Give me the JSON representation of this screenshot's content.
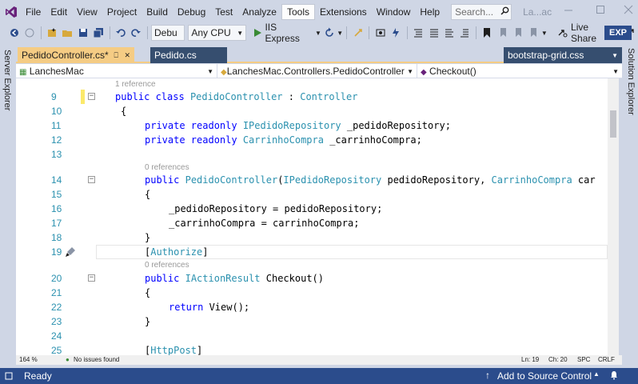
{
  "menu": {
    "items": [
      "File",
      "Edit",
      "View",
      "Project",
      "Build",
      "Debug",
      "Test",
      "Analyze",
      "Tools",
      "Extensions",
      "Window",
      "Help"
    ],
    "active": "Tools",
    "search_placeholder": "Search...",
    "solution_name": "La...ac"
  },
  "toolbar": {
    "config": "Debu",
    "platform": "Any CPU",
    "run_target": "IIS Express",
    "live_share": "Live Share",
    "exp_badge": "EXP"
  },
  "side_panels": {
    "left": "Server Explorer",
    "right": "Solution Explorer"
  },
  "tabs": {
    "active": "PedidoController.cs*",
    "inactive": "Pedido.cs",
    "preview": "bootstrap-grid.css"
  },
  "nav": {
    "project": "LanchesMac",
    "class": "LanchesMac.Controllers.PedidoController",
    "member": "Checkout()"
  },
  "code": {
    "lines": [
      {
        "n": "9",
        "ref": "1 reference",
        "text": "public class PedidoController : Controller"
      },
      {
        "n": "10",
        "text": "{"
      },
      {
        "n": "11",
        "text": "private readonly IPedidoRepository _pedidoRepository;"
      },
      {
        "n": "12",
        "text": "private readonly CarrinhoCompra _carrinhoCompra;"
      },
      {
        "n": "13",
        "text": ""
      },
      {
        "n": "14",
        "ref": "0 references",
        "text": "public PedidoController(IPedidoRepository pedidoRepository, CarrinhoCompra car"
      },
      {
        "n": "15",
        "text": "{"
      },
      {
        "n": "16",
        "text": "_pedidoRepository = pedidoRepository;"
      },
      {
        "n": "17",
        "text": "_carrinhoCompra = carrinhoCompra;"
      },
      {
        "n": "18",
        "text": "}"
      },
      {
        "n": "19",
        "text": "[Authorize]"
      },
      {
        "n": "20",
        "ref": "0 references",
        "text": "public IActionResult Checkout()"
      },
      {
        "n": "21",
        "text": "{"
      },
      {
        "n": "22",
        "text": "return View();"
      },
      {
        "n": "23",
        "text": "}"
      },
      {
        "n": "24",
        "text": ""
      },
      {
        "n": "25",
        "text": "[HttpPost]"
      }
    ]
  },
  "editor_status": {
    "zoom": "164 %",
    "issues": "No issues found",
    "line": "Ln: 19",
    "col": "Ch: 20",
    "spc": "SPC",
    "crlf": "CRLF"
  },
  "status": {
    "ready": "Ready",
    "source_control": "Add to Source Control"
  },
  "colors": {
    "accent": "#2b4c8c",
    "tab_active": "#f5cc84",
    "keyword": "#0000ff",
    "type": "#2b91af"
  }
}
